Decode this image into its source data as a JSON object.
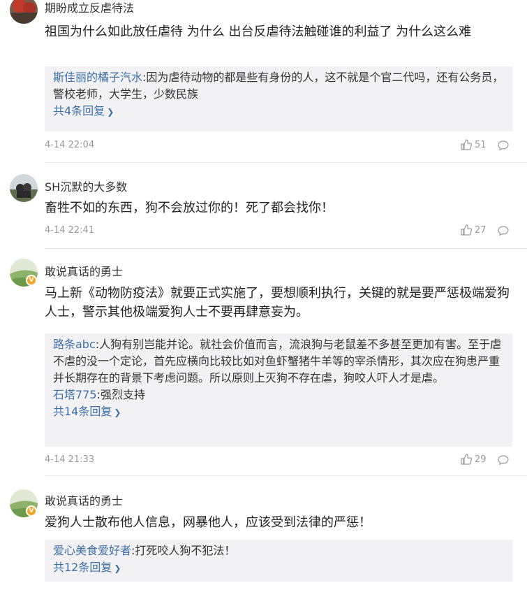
{
  "comments": [
    {
      "username": "期盼成立反虐待法",
      "text": "祖国为什么如此放任虐待 为什么 出台反虐待法触碰谁的利益了 为什么这么难",
      "replies": [
        {
          "name": "斯佳丽的橘子汽水",
          "text": "因为虐待动物的都是些有身份的人，这不就是个官二代吗，还有公务员，警校老师，大学生，少数民族"
        }
      ],
      "more": "共4条回复",
      "time": "4-14 22:04",
      "likes": "51"
    },
    {
      "username": "SH沉默的大多数",
      "text": "畜牲不如的东西，狗不会放过你的！死了都会找你！",
      "replies": [],
      "more": "",
      "time": "4-14 22:41",
      "likes": "27"
    },
    {
      "username": "敢说真话的勇士",
      "text": "马上新《动物防疫法》就要正式实施了，要想顺利执行，关键的就是要严惩极端爱狗人士，警示其他极端爱狗人士不要再肆意妄为。",
      "replies": [
        {
          "name": "路条abc",
          "text": "人狗有别岂能并论。就社会价值而言，流浪狗与老鼠差不多甚至更加有害。至于虐不虐的没一个定论，首先应横向比较比如对鱼虾蟹猪牛羊等的宰杀情形，其次应在狗患严重并长期存在的背景下考虑问题。所以原则上灭狗不存在虐，狗咬人吓人才是虐。"
        },
        {
          "name": "石塔775",
          "text": "强烈支持"
        }
      ],
      "more": "共14条回复",
      "time": "4-14 21:33",
      "likes": "29"
    },
    {
      "username": "敢说真话的勇士",
      "text": "爱狗人士散布他人信息，网暴他人，应该受到法律的严惩！",
      "replies": [
        {
          "name": "爱心美食爱好者",
          "text": "打死咬人狗不犯法！"
        }
      ],
      "more": "共12条回复",
      "time": "",
      "likes": ""
    }
  ],
  "icons": {
    "like": "thumbs-up-icon",
    "comment": "speech-bubble-icon",
    "verified": "verified-badge-icon",
    "chevron": "chevron-right-icon"
  },
  "colors": {
    "link": "#3d6fa8",
    "reply_bg": "#f2f2f5",
    "meta": "#999999",
    "badge": "#f5a623"
  }
}
